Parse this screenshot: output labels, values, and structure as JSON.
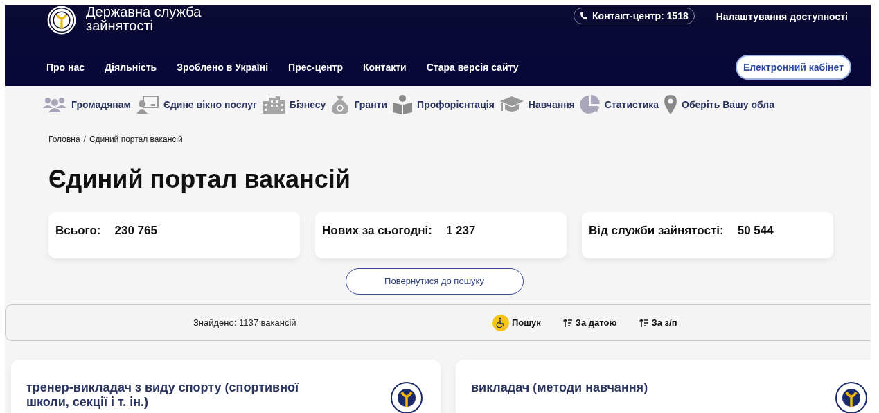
{
  "header": {
    "site_title": "Державна служба зайнятості",
    "contact": "Контакт-центр: 1518",
    "accessibility": "Налаштування доступності",
    "cabinet_button": "Електронний кабінет"
  },
  "nav": [
    "Про нас",
    "Діяльність",
    "Зроблено в Україні",
    "Прес-центр",
    "Контакти",
    "Стара версія сайту"
  ],
  "categories": [
    {
      "label": "Громадянам",
      "kind": "people"
    },
    {
      "label": "Єдине вікно послуг",
      "kind": "desk"
    },
    {
      "label": "Бізнесу",
      "kind": "building"
    },
    {
      "label": "Гранти",
      "kind": "money"
    },
    {
      "label": "Профорієнтація",
      "kind": "reader"
    },
    {
      "label": "Навчання",
      "kind": "cap"
    },
    {
      "label": "Статистика",
      "kind": "pie"
    },
    {
      "label": "Оберіть Вашу обла",
      "kind": "pin"
    }
  ],
  "breadcrumb": {
    "items": [
      "Головна",
      "Єдиний портал вакансій"
    ],
    "separator": "/"
  },
  "title": "Єдиний портал вакансій",
  "stats": [
    {
      "label": "Всього:",
      "value": "230 765"
    },
    {
      "label": "Нових за сьогодні:",
      "value": "1 237"
    },
    {
      "label": "Від служби зайнятості:",
      "value": "50 544"
    }
  ],
  "back_button": "Повернутися до пошуку",
  "results": {
    "found": "Знайдено:  1137 вакансій",
    "actions": [
      {
        "label": "Пошук",
        "kind": "accessibility"
      },
      {
        "label": "За датою",
        "kind": "sort"
      },
      {
        "label": "За з/п",
        "kind": "sort"
      }
    ]
  },
  "vacancies": [
    {
      "title": "тренер-викладач з виду спорту (спортивної школи, секції і т. ін.)"
    },
    {
      "title": "викладач (методи навчання)"
    }
  ]
}
